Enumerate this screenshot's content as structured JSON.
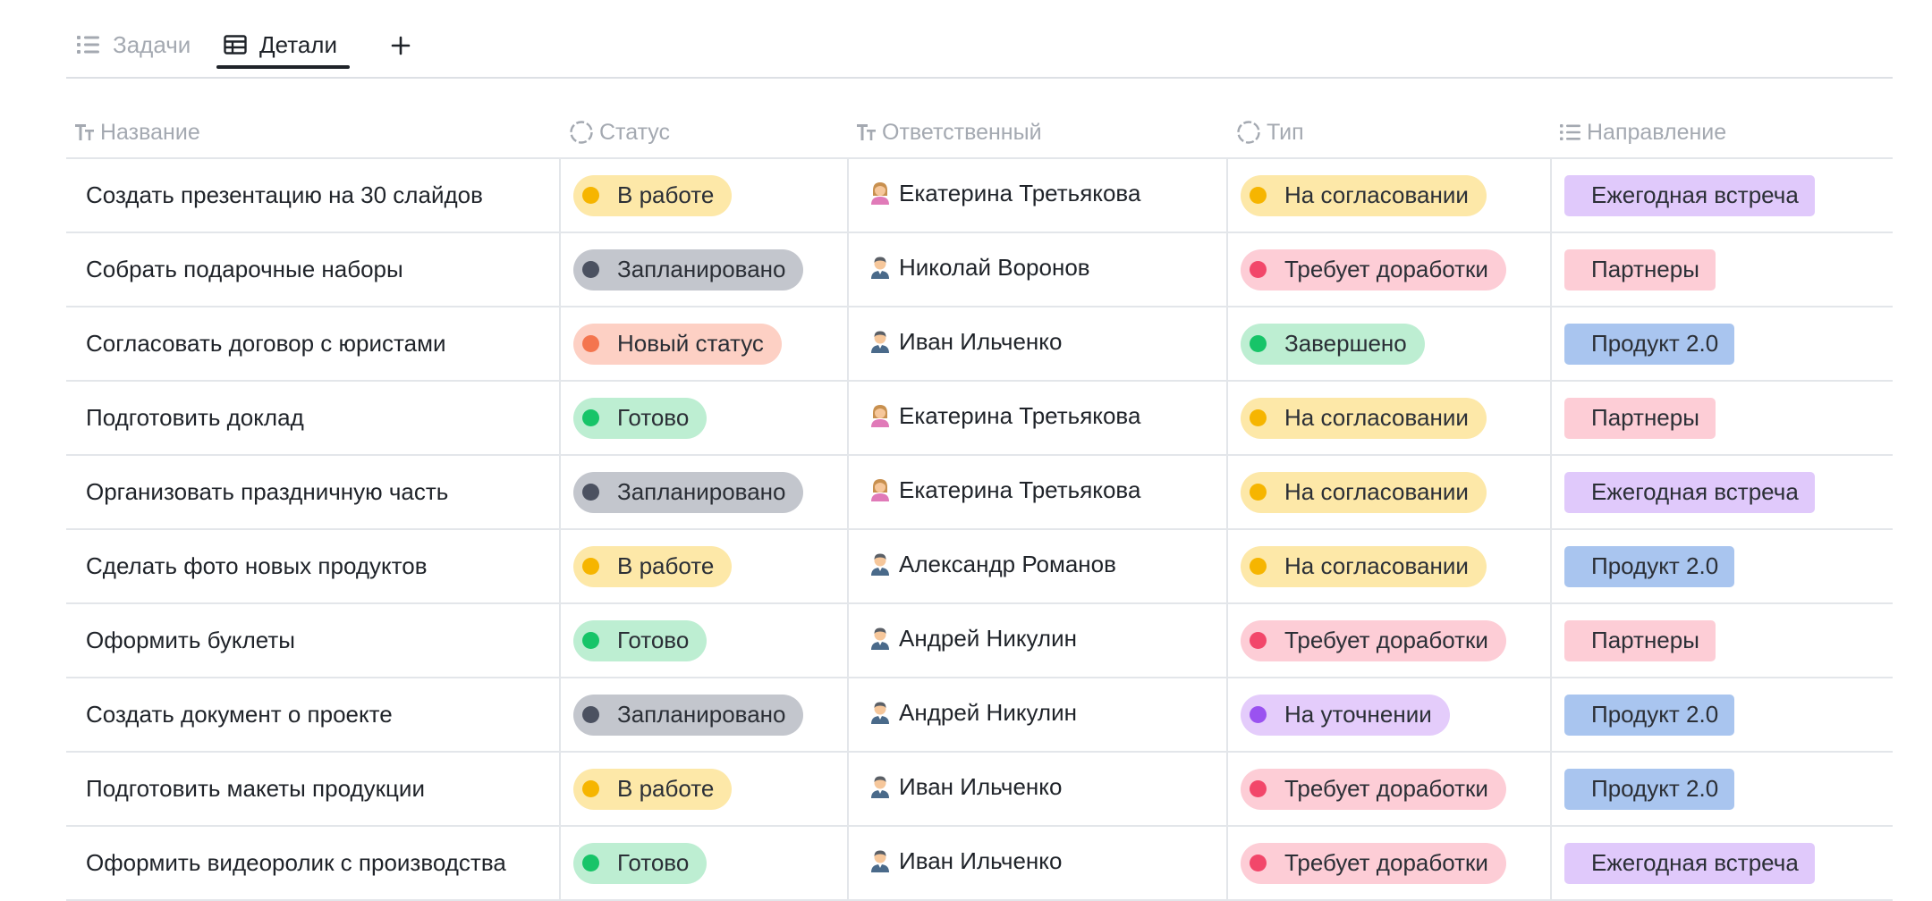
{
  "tabs": [
    {
      "label": "Задачи",
      "icon": "list-icon",
      "active": false
    },
    {
      "label": "Детали",
      "icon": "table-icon",
      "active": true
    }
  ],
  "add_tab_icon": "plus-icon",
  "columns": [
    {
      "label": "Название",
      "icon": "text-type-icon"
    },
    {
      "label": "Статус",
      "icon": "status-circle-icon"
    },
    {
      "label": "Ответственный",
      "icon": "text-type-icon"
    },
    {
      "label": "Тип",
      "icon": "status-circle-icon"
    },
    {
      "label": "Направление",
      "icon": "list-icon"
    }
  ],
  "rows": [
    {
      "name": "Создать презентацию на 30 слайдов",
      "status": "В работе",
      "owner": "Екатерина Третьякова",
      "owner_avatar": "woman-avatar",
      "type": "На согласовании",
      "direction": "Ежегодная встреча"
    },
    {
      "name": "Собрать подарочные наборы",
      "status": "Запланировано",
      "owner": "Николай Воронов",
      "owner_avatar": "man-avatar",
      "type": "Требует доработки",
      "direction": "Партнеры"
    },
    {
      "name": "Согласовать договор с юристами",
      "status": "Новый статус",
      "owner": "Иван Ильченко",
      "owner_avatar": "man-avatar",
      "type": "Завершено",
      "direction": "Продукт 2.0"
    },
    {
      "name": "Подготовить доклад",
      "status": "Готово",
      "owner": "Екатерина Третьякова",
      "owner_avatar": "woman-avatar",
      "type": "На согласовании",
      "direction": "Партнеры"
    },
    {
      "name": "Организовать праздничную часть",
      "status": "Запланировано",
      "owner": "Екатерина Третьякова",
      "owner_avatar": "woman-avatar",
      "type": "На согласовании",
      "direction": "Ежегодная встреча"
    },
    {
      "name": "Сделать фото новых продуктов",
      "status": "В работе",
      "owner": "Александр Романов",
      "owner_avatar": "man-avatar",
      "type": "На согласовании",
      "direction": "Продукт 2.0"
    },
    {
      "name": "Оформить буклеты",
      "status": "Готово",
      "owner": "Андрей Никулин",
      "owner_avatar": "man-avatar",
      "type": "Требует доработки",
      "direction": "Партнеры"
    },
    {
      "name": "Создать документ о проекте",
      "status": "Запланировано",
      "owner": "Андрей Никулин",
      "owner_avatar": "man-avatar",
      "type": "На уточнении",
      "direction": "Продукт 2.0"
    },
    {
      "name": "Подготовить макеты продукции",
      "status": "В работе",
      "owner": "Иван Ильченко",
      "owner_avatar": "man-avatar",
      "type": "Требует доработки",
      "direction": "Продукт 2.0"
    },
    {
      "name": "Оформить видеоролик с производства",
      "status": "Готово",
      "owner": "Иван Ильченко",
      "owner_avatar": "man-avatar",
      "type": "Требует доработки",
      "direction": "Ежегодная встреча"
    }
  ],
  "pill_colors": {
    "В работе": {
      "bg": "#fde8a8",
      "dot": "#f6b500"
    },
    "Запланировано": {
      "bg": "#c3c6cd",
      "dot": "#4b5160"
    },
    "Новый статус": {
      "bg": "#fdd0c4",
      "dot": "#f4754e"
    },
    "Готово": {
      "bg": "#bdeed2",
      "dot": "#17c468"
    },
    "На согласовании": {
      "bg": "#fde8a8",
      "dot": "#f6b500"
    },
    "Требует доработки": {
      "bg": "#fdcdd6",
      "dot": "#f2476a"
    },
    "Завершено": {
      "bg": "#bdeed2",
      "dot": "#17c468"
    },
    "На уточнении": {
      "bg": "#e4ccfb",
      "dot": "#9a52f0"
    }
  },
  "tag_colors": {
    "Ежегодная встреча": "#e0c9fb",
    "Партнеры": "#fdcdd6",
    "Продукт 2.0": "#a9c5ef"
  }
}
